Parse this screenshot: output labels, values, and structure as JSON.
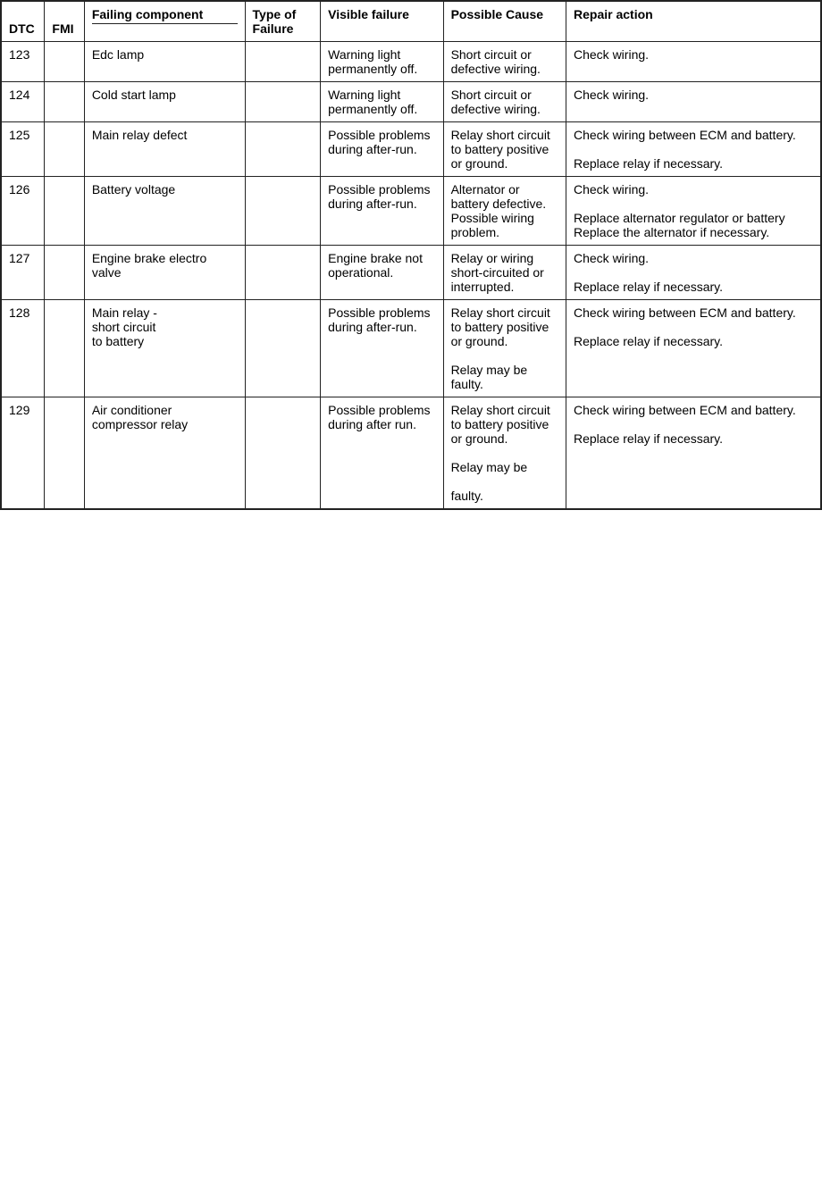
{
  "table": {
    "headers": {
      "dtc": "DTC",
      "fmi": "FMI",
      "failing_component": "Failing component",
      "type_of_failure": "Type of Failure",
      "visible_failure": "Visible failure",
      "possible_cause": "Possible Cause",
      "repair_action": "Repair action"
    },
    "rows": [
      {
        "dtc": "123",
        "fmi": "",
        "failing_component": "Edc lamp",
        "type_of_failure": "",
        "visible_failure": "Warning light permanently off.",
        "possible_cause": "Short circuit or defective wiring.",
        "repair_action": "Check wiring."
      },
      {
        "dtc": "124",
        "fmi": "",
        "failing_component": "Cold start lamp",
        "type_of_failure": "",
        "visible_failure": "Warning light permanently off.",
        "possible_cause": "Short circuit or defective wiring.",
        "repair_action": "Check wiring."
      },
      {
        "dtc": "125",
        "fmi": "",
        "failing_component": "Main relay defect",
        "type_of_failure": "",
        "visible_failure": "Possible problems during after-run.",
        "possible_cause": "Relay short circuit to battery positive or ground.",
        "repair_action": "Check wiring between ECM and battery.\n\nReplace relay if necessary."
      },
      {
        "dtc": "126",
        "fmi": "",
        "failing_component": "Battery voltage",
        "type_of_failure": "",
        "visible_failure": "Possible problems during after-run.",
        "possible_cause": "Alternator or battery defective. Possible wiring problem.",
        "repair_action": "Check wiring.\n\nReplace alternator regulator or battery Replace the alternator if necessary."
      },
      {
        "dtc": "127",
        "fmi": "",
        "failing_component": "Engine brake electro valve",
        "type_of_failure": "",
        "visible_failure": "Engine brake not operational.",
        "possible_cause": "Relay or wiring short-circuited or interrupted.",
        "repair_action": "Check wiring.\n\nReplace relay if necessary."
      },
      {
        "dtc": "128",
        "fmi": "",
        "failing_component": "Main relay    -\nshort circuit\nto           battery",
        "type_of_failure": "",
        "visible_failure": "Possible problems during after-run.",
        "possible_cause": "Relay short circuit to battery positive or ground.\n\nRelay may be faulty.",
        "repair_action": "Check wiring between ECM and battery.\n\nReplace relay if necessary."
      },
      {
        "dtc": "129",
        "fmi": "",
        "failing_component": "Air conditioner compressor relay",
        "type_of_failure": "",
        "visible_failure": "Possible problems during after run.",
        "possible_cause": "Relay short circuit to battery positive or ground.\n\nRelay may be\n\nfaulty.",
        "repair_action": "Check wiring between ECM and battery.\n\nReplace relay if necessary."
      }
    ]
  }
}
